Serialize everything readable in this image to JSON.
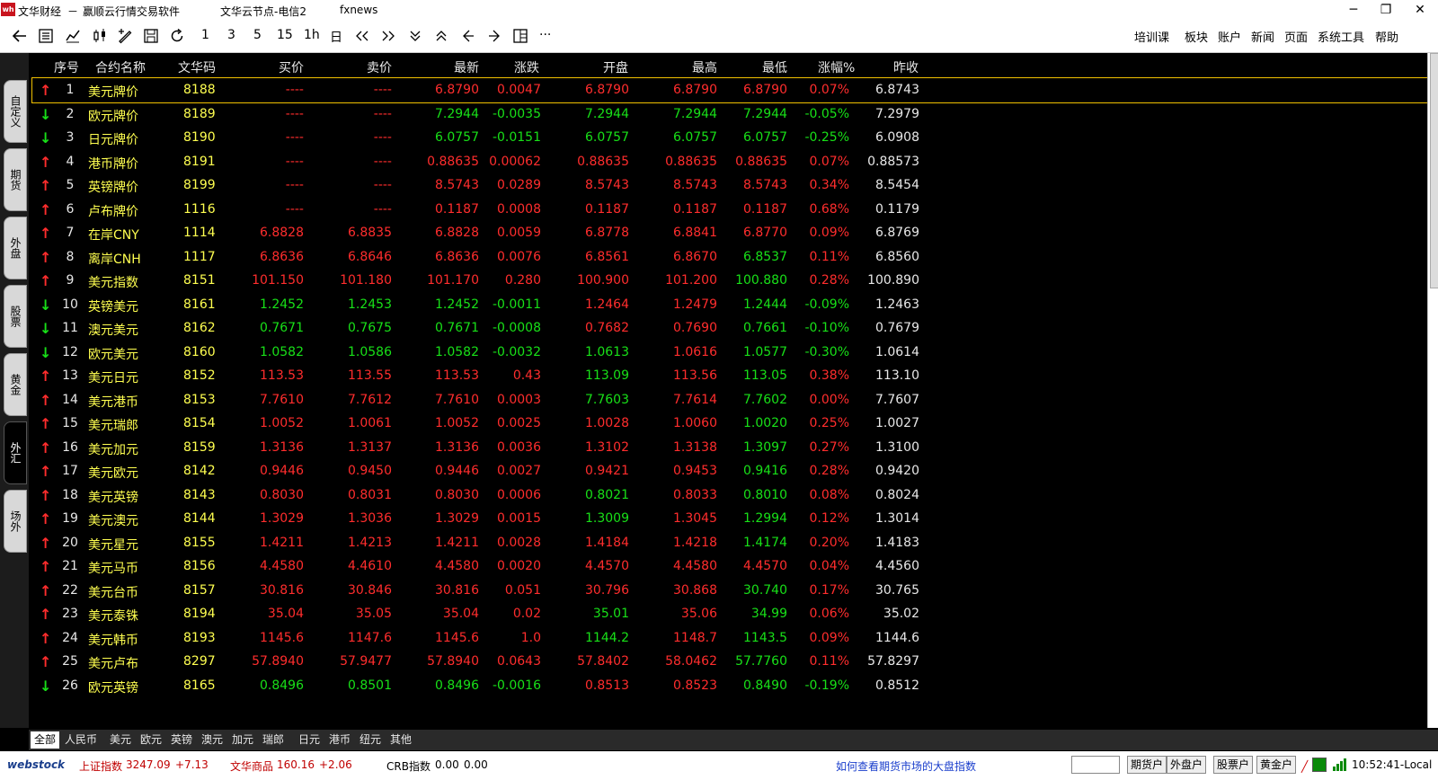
{
  "titlebar": {
    "app_name": "文华财经",
    "separator": "－",
    "subtitle": "赢顺云行情交易软件",
    "node": "文华云节点-电信2",
    "news": "fxnews",
    "minimize": "─",
    "restore": "❐",
    "close": "✕"
  },
  "toolbar": {
    "periods": [
      "1",
      "3",
      "5",
      "15",
      "1h",
      "日"
    ],
    "more": "···",
    "menus": [
      "培训课",
      "板块",
      "账户",
      "新闻",
      "页面",
      "系统工具",
      "帮助"
    ]
  },
  "left_tabs": [
    "自定义",
    "期货",
    "外盘",
    "股票",
    "黄金",
    "外汇",
    "场外"
  ],
  "left_tab_active": "外汇",
  "columns": [
    "序号",
    "合约名称",
    "文华码",
    "买价",
    "卖价",
    "最新",
    "涨跌",
    "开盘",
    "最高",
    "最低",
    "涨幅%",
    "昨收"
  ],
  "rows": [
    {
      "dir": "up",
      "no": "1",
      "name": "美元牌价",
      "code": "8188",
      "bid": "----",
      "ask": "----",
      "last": "6.8790",
      "chg": "0.0047",
      "open": "6.8790",
      "high": "6.8790",
      "low": "6.8790",
      "pct": "0.07%",
      "prev": "6.8743",
      "bidc": "up",
      "askc": "up",
      "lastc": "up",
      "chgc": "up",
      "openc": "up",
      "highc": "up",
      "lowc": "up",
      "pctc": "up"
    },
    {
      "dir": "dn",
      "no": "2",
      "name": "欧元牌价",
      "code": "8189",
      "bid": "----",
      "ask": "----",
      "last": "7.2944",
      "chg": "-0.0035",
      "open": "7.2944",
      "high": "7.2944",
      "low": "7.2944",
      "pct": "-0.05%",
      "prev": "7.2979",
      "bidc": "up",
      "askc": "up",
      "lastc": "dn",
      "chgc": "dn",
      "openc": "dn",
      "highc": "dn",
      "lowc": "dn",
      "pctc": "dn"
    },
    {
      "dir": "dn",
      "no": "3",
      "name": "日元牌价",
      "code": "8190",
      "bid": "----",
      "ask": "----",
      "last": "6.0757",
      "chg": "-0.0151",
      "open": "6.0757",
      "high": "6.0757",
      "low": "6.0757",
      "pct": "-0.25%",
      "prev": "6.0908",
      "bidc": "up",
      "askc": "up",
      "lastc": "dn",
      "chgc": "dn",
      "openc": "dn",
      "highc": "dn",
      "lowc": "dn",
      "pctc": "dn"
    },
    {
      "dir": "up",
      "no": "4",
      "name": "港币牌价",
      "code": "8191",
      "bid": "----",
      "ask": "----",
      "last": "0.88635",
      "chg": "0.00062",
      "open": "0.88635",
      "high": "0.88635",
      "low": "0.88635",
      "pct": "0.07%",
      "prev": "0.88573",
      "bidc": "up",
      "askc": "up",
      "lastc": "up",
      "chgc": "up",
      "openc": "up",
      "highc": "up",
      "lowc": "up",
      "pctc": "up"
    },
    {
      "dir": "up",
      "no": "5",
      "name": "英镑牌价",
      "code": "8199",
      "bid": "----",
      "ask": "----",
      "last": "8.5743",
      "chg": "0.0289",
      "open": "8.5743",
      "high": "8.5743",
      "low": "8.5743",
      "pct": "0.34%",
      "prev": "8.5454",
      "bidc": "up",
      "askc": "up",
      "lastc": "up",
      "chgc": "up",
      "openc": "up",
      "highc": "up",
      "lowc": "up",
      "pctc": "up"
    },
    {
      "dir": "up",
      "no": "6",
      "name": "卢布牌价",
      "code": "1116",
      "bid": "----",
      "ask": "----",
      "last": "0.1187",
      "chg": "0.0008",
      "open": "0.1187",
      "high": "0.1187",
      "low": "0.1187",
      "pct": "0.68%",
      "prev": "0.1179",
      "bidc": "up",
      "askc": "up",
      "lastc": "up",
      "chgc": "up",
      "openc": "up",
      "highc": "up",
      "lowc": "up",
      "pctc": "up"
    },
    {
      "dir": "up",
      "no": "7",
      "name": "在岸CNY",
      "code": "1114",
      "bid": "6.8828",
      "ask": "6.8835",
      "last": "6.8828",
      "chg": "0.0059",
      "open": "6.8778",
      "high": "6.8841",
      "low": "6.8770",
      "pct": "0.09%",
      "prev": "6.8769",
      "bidc": "up",
      "askc": "up",
      "lastc": "up",
      "chgc": "up",
      "openc": "up",
      "highc": "up",
      "lowc": "up",
      "pctc": "up"
    },
    {
      "dir": "up",
      "no": "8",
      "name": "离岸CNH",
      "code": "1117",
      "bid": "6.8636",
      "ask": "6.8646",
      "last": "6.8636",
      "chg": "0.0076",
      "open": "6.8561",
      "high": "6.8670",
      "low": "6.8537",
      "pct": "0.11%",
      "prev": "6.8560",
      "bidc": "up",
      "askc": "up",
      "lastc": "up",
      "chgc": "up",
      "openc": "up",
      "highc": "up",
      "lowc": "dn",
      "pctc": "up"
    },
    {
      "dir": "up",
      "no": "9",
      "name": "美元指数",
      "code": "8151",
      "bid": "101.150",
      "ask": "101.180",
      "last": "101.170",
      "chg": "0.280",
      "open": "100.900",
      "high": "101.200",
      "low": "100.880",
      "pct": "0.28%",
      "prev": "100.890",
      "bidc": "up",
      "askc": "up",
      "lastc": "up",
      "chgc": "up",
      "openc": "up",
      "highc": "up",
      "lowc": "dn",
      "pctc": "up"
    },
    {
      "dir": "dn",
      "no": "10",
      "name": "英镑美元",
      "code": "8161",
      "bid": "1.2452",
      "ask": "1.2453",
      "last": "1.2452",
      "chg": "-0.0011",
      "open": "1.2464",
      "high": "1.2479",
      "low": "1.2444",
      "pct": "-0.09%",
      "prev": "1.2463",
      "bidc": "dn",
      "askc": "dn",
      "lastc": "dn",
      "chgc": "dn",
      "openc": "up",
      "highc": "up",
      "lowc": "dn",
      "pctc": "dn"
    },
    {
      "dir": "dn",
      "no": "11",
      "name": "澳元美元",
      "code": "8162",
      "bid": "0.7671",
      "ask": "0.7675",
      "last": "0.7671",
      "chg": "-0.0008",
      "open": "0.7682",
      "high": "0.7690",
      "low": "0.7661",
      "pct": "-0.10%",
      "prev": "0.7679",
      "bidc": "dn",
      "askc": "dn",
      "lastc": "dn",
      "chgc": "dn",
      "openc": "up",
      "highc": "up",
      "lowc": "dn",
      "pctc": "dn"
    },
    {
      "dir": "dn",
      "no": "12",
      "name": "欧元美元",
      "code": "8160",
      "bid": "1.0582",
      "ask": "1.0586",
      "last": "1.0582",
      "chg": "-0.0032",
      "open": "1.0613",
      "high": "1.0616",
      "low": "1.0577",
      "pct": "-0.30%",
      "prev": "1.0614",
      "bidc": "dn",
      "askc": "dn",
      "lastc": "dn",
      "chgc": "dn",
      "openc": "dn",
      "highc": "up",
      "lowc": "dn",
      "pctc": "dn"
    },
    {
      "dir": "up",
      "no": "13",
      "name": "美元日元",
      "code": "8152",
      "bid": "113.53",
      "ask": "113.55",
      "last": "113.53",
      "chg": "0.43",
      "open": "113.09",
      "high": "113.56",
      "low": "113.05",
      "pct": "0.38%",
      "prev": "113.10",
      "bidc": "up",
      "askc": "up",
      "lastc": "up",
      "chgc": "up",
      "openc": "dn",
      "highc": "up",
      "lowc": "dn",
      "pctc": "up"
    },
    {
      "dir": "up",
      "no": "14",
      "name": "美元港币",
      "code": "8153",
      "bid": "7.7610",
      "ask": "7.7612",
      "last": "7.7610",
      "chg": "0.0003",
      "open": "7.7603",
      "high": "7.7614",
      "low": "7.7602",
      "pct": "0.00%",
      "prev": "7.7607",
      "bidc": "up",
      "askc": "up",
      "lastc": "up",
      "chgc": "up",
      "openc": "dn",
      "highc": "up",
      "lowc": "dn",
      "pctc": "up"
    },
    {
      "dir": "up",
      "no": "15",
      "name": "美元瑞郎",
      "code": "8154",
      "bid": "1.0052",
      "ask": "1.0061",
      "last": "1.0052",
      "chg": "0.0025",
      "open": "1.0028",
      "high": "1.0060",
      "low": "1.0020",
      "pct": "0.25%",
      "prev": "1.0027",
      "bidc": "up",
      "askc": "up",
      "lastc": "up",
      "chgc": "up",
      "openc": "up",
      "highc": "up",
      "lowc": "dn",
      "pctc": "up"
    },
    {
      "dir": "up",
      "no": "16",
      "name": "美元加元",
      "code": "8159",
      "bid": "1.3136",
      "ask": "1.3137",
      "last": "1.3136",
      "chg": "0.0036",
      "open": "1.3102",
      "high": "1.3138",
      "low": "1.3097",
      "pct": "0.27%",
      "prev": "1.3100",
      "bidc": "up",
      "askc": "up",
      "lastc": "up",
      "chgc": "up",
      "openc": "up",
      "highc": "up",
      "lowc": "dn",
      "pctc": "up"
    },
    {
      "dir": "up",
      "no": "17",
      "name": "美元欧元",
      "code": "8142",
      "bid": "0.9446",
      "ask": "0.9450",
      "last": "0.9446",
      "chg": "0.0027",
      "open": "0.9421",
      "high": "0.9453",
      "low": "0.9416",
      "pct": "0.28%",
      "prev": "0.9420",
      "bidc": "up",
      "askc": "up",
      "lastc": "up",
      "chgc": "up",
      "openc": "up",
      "highc": "up",
      "lowc": "dn",
      "pctc": "up"
    },
    {
      "dir": "up",
      "no": "18",
      "name": "美元英镑",
      "code": "8143",
      "bid": "0.8030",
      "ask": "0.8031",
      "last": "0.8030",
      "chg": "0.0006",
      "open": "0.8021",
      "high": "0.8033",
      "low": "0.8010",
      "pct": "0.08%",
      "prev": "0.8024",
      "bidc": "up",
      "askc": "up",
      "lastc": "up",
      "chgc": "up",
      "openc": "dn",
      "highc": "up",
      "lowc": "dn",
      "pctc": "up"
    },
    {
      "dir": "up",
      "no": "19",
      "name": "美元澳元",
      "code": "8144",
      "bid": "1.3029",
      "ask": "1.3036",
      "last": "1.3029",
      "chg": "0.0015",
      "open": "1.3009",
      "high": "1.3045",
      "low": "1.2994",
      "pct": "0.12%",
      "prev": "1.3014",
      "bidc": "up",
      "askc": "up",
      "lastc": "up",
      "chgc": "up",
      "openc": "dn",
      "highc": "up",
      "lowc": "dn",
      "pctc": "up"
    },
    {
      "dir": "up",
      "no": "20",
      "name": "美元星元",
      "code": "8155",
      "bid": "1.4211",
      "ask": "1.4213",
      "last": "1.4211",
      "chg": "0.0028",
      "open": "1.4184",
      "high": "1.4218",
      "low": "1.4174",
      "pct": "0.20%",
      "prev": "1.4183",
      "bidc": "up",
      "askc": "up",
      "lastc": "up",
      "chgc": "up",
      "openc": "up",
      "highc": "up",
      "lowc": "dn",
      "pctc": "up"
    },
    {
      "dir": "up",
      "no": "21",
      "name": "美元马币",
      "code": "8156",
      "bid": "4.4580",
      "ask": "4.4610",
      "last": "4.4580",
      "chg": "0.0020",
      "open": "4.4570",
      "high": "4.4580",
      "low": "4.4570",
      "pct": "0.04%",
      "prev": "4.4560",
      "bidc": "up",
      "askc": "up",
      "lastc": "up",
      "chgc": "up",
      "openc": "up",
      "highc": "up",
      "lowc": "up",
      "pctc": "up"
    },
    {
      "dir": "up",
      "no": "22",
      "name": "美元台币",
      "code": "8157",
      "bid": "30.816",
      "ask": "30.846",
      "last": "30.816",
      "chg": "0.051",
      "open": "30.796",
      "high": "30.868",
      "low": "30.740",
      "pct": "0.17%",
      "prev": "30.765",
      "bidc": "up",
      "askc": "up",
      "lastc": "up",
      "chgc": "up",
      "openc": "up",
      "highc": "up",
      "lowc": "dn",
      "pctc": "up"
    },
    {
      "dir": "up",
      "no": "23",
      "name": "美元泰铢",
      "code": "8194",
      "bid": "35.04",
      "ask": "35.05",
      "last": "35.04",
      "chg": "0.02",
      "open": "35.01",
      "high": "35.06",
      "low": "34.99",
      "pct": "0.06%",
      "prev": "35.02",
      "bidc": "up",
      "askc": "up",
      "lastc": "up",
      "chgc": "up",
      "openc": "dn",
      "highc": "up",
      "lowc": "dn",
      "pctc": "up"
    },
    {
      "dir": "up",
      "no": "24",
      "name": "美元韩币",
      "code": "8193",
      "bid": "1145.6",
      "ask": "1147.6",
      "last": "1145.6",
      "chg": "1.0",
      "open": "1144.2",
      "high": "1148.7",
      "low": "1143.5",
      "pct": "0.09%",
      "prev": "1144.6",
      "bidc": "up",
      "askc": "up",
      "lastc": "up",
      "chgc": "up",
      "openc": "dn",
      "highc": "up",
      "lowc": "dn",
      "pctc": "up"
    },
    {
      "dir": "up",
      "no": "25",
      "name": "美元卢布",
      "code": "8297",
      "bid": "57.8940",
      "ask": "57.9477",
      "last": "57.8940",
      "chg": "0.0643",
      "open": "57.8402",
      "high": "58.0462",
      "low": "57.7760",
      "pct": "0.11%",
      "prev": "57.8297",
      "bidc": "up",
      "askc": "up",
      "lastc": "up",
      "chgc": "up",
      "openc": "up",
      "highc": "up",
      "lowc": "dn",
      "pctc": "up"
    },
    {
      "dir": "dn",
      "no": "26",
      "name": "欧元英镑",
      "code": "8165",
      "bid": "0.8496",
      "ask": "0.8501",
      "last": "0.8496",
      "chg": "-0.0016",
      "open": "0.8513",
      "high": "0.8523",
      "low": "0.8490",
      "pct": "-0.19%",
      "prev": "0.8512",
      "bidc": "dn",
      "askc": "dn",
      "lastc": "dn",
      "chgc": "dn",
      "openc": "up",
      "highc": "up",
      "lowc": "dn",
      "pctc": "dn"
    }
  ],
  "bottom_tabs": [
    "全部",
    "人民币",
    "美元",
    "欧元",
    "英镑",
    "澳元",
    "加元",
    "瑞郎",
    "日元",
    "港币",
    "纽元",
    "其他"
  ],
  "bottom_tab_active": "全部",
  "statusbar": {
    "brand": "webstock",
    "index1_name": "上证指数",
    "index1_value": "3247.09",
    "index1_chg": "+7.13",
    "index2_name": "文华商品",
    "index2_value": "160.16",
    "index2_chg": "+2.06",
    "index3_name": "CRB指数",
    "index3_value": "0.00",
    "index3_chg": "0.00",
    "news_link": "如何查看期货市场的大盘指数",
    "buttons": [
      "期货户",
      "外盘户",
      "股票户",
      "黄金户"
    ],
    "time": "10:52:41-Local"
  },
  "colors": {
    "up": "#ff2d2d",
    "down": "#18e018",
    "name": "#ffff50",
    "background": "#000000"
  }
}
